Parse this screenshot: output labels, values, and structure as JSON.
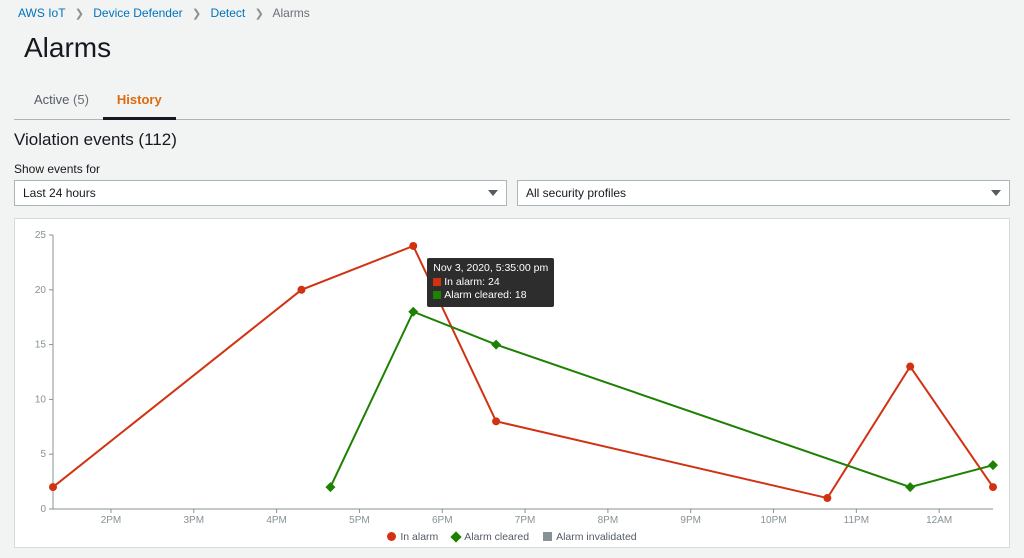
{
  "breadcrumb": {
    "items": [
      {
        "label": "AWS IoT",
        "link": true
      },
      {
        "label": "Device Defender",
        "link": true
      },
      {
        "label": "Detect",
        "link": true
      },
      {
        "label": "Alarms",
        "link": false
      }
    ]
  },
  "page": {
    "title": "Alarms"
  },
  "tabs": {
    "active": {
      "label": "Active",
      "count": "(5)"
    },
    "history": {
      "label": "History"
    }
  },
  "section": {
    "title": "Violation events (112)",
    "filters_label": "Show events for",
    "time_range": "Last 24 hours",
    "profile": "All security profiles"
  },
  "tooltip": {
    "header": "Nov 3, 2020, 5:35:00 pm",
    "row1": "In alarm: 24",
    "row2": "Alarm cleared: 18"
  },
  "legend": {
    "in_alarm": "In alarm",
    "cleared": "Alarm cleared",
    "invalidated": "Alarm invalidated"
  },
  "chart_data": {
    "type": "line",
    "xlabel": "",
    "ylabel": "",
    "ylim": [
      0,
      25
    ],
    "y_ticks": [
      0,
      5,
      10,
      15,
      20,
      25
    ],
    "x_ticks": [
      "2PM",
      "3PM",
      "4PM",
      "5PM",
      "6PM",
      "7PM",
      "8PM",
      "9PM",
      "10PM",
      "11PM",
      "12AM"
    ],
    "x_tick_positions": [
      2,
      3,
      4,
      5,
      6,
      7,
      8,
      9,
      10,
      11,
      12
    ],
    "series": [
      {
        "name": "In alarm",
        "color": "#d13212",
        "marker": "circle",
        "points": [
          [
            1.3,
            2
          ],
          [
            4.3,
            20
          ],
          [
            5.65,
            24
          ],
          [
            6.65,
            8
          ],
          [
            10.65,
            1
          ],
          [
            11.65,
            13
          ],
          [
            12.65,
            2
          ]
        ]
      },
      {
        "name": "Alarm cleared",
        "color": "#1d8102",
        "marker": "diamond",
        "points": [
          [
            4.65,
            2
          ],
          [
            5.65,
            18
          ],
          [
            6.65,
            15
          ],
          [
            11.65,
            2
          ],
          [
            12.65,
            4
          ]
        ]
      },
      {
        "name": "Alarm invalidated",
        "color": "#879196",
        "marker": "square",
        "points": []
      }
    ]
  }
}
